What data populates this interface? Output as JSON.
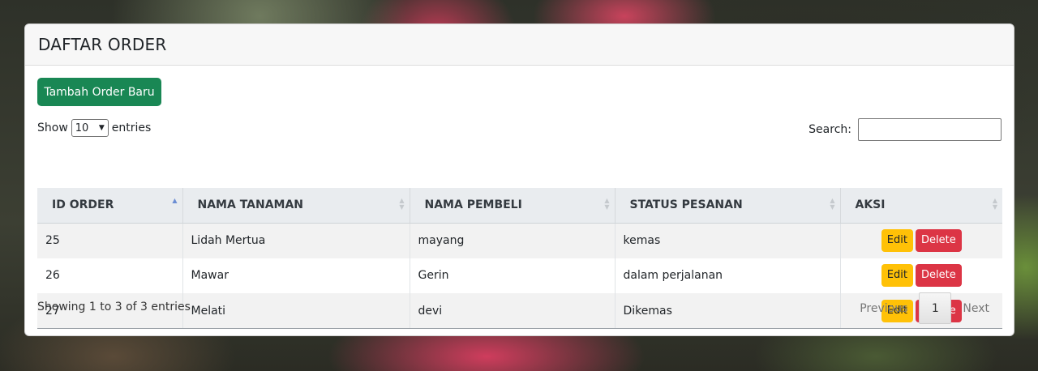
{
  "page_title": "DAFTAR ORDER",
  "add_button": "Tambah Order Baru",
  "length": {
    "prefix": "Show",
    "value": "10",
    "suffix": "entries"
  },
  "search": {
    "label": "Search:",
    "value": ""
  },
  "table": {
    "headers": [
      "ID ORDER",
      "NAMA TANAMAN",
      "NAMA PEMBELI",
      "STATUS PESANAN",
      "AKSI"
    ],
    "sorted_column": "ID ORDER",
    "sort_direction": "ascending",
    "rows": [
      {
        "id": "25",
        "tanaman": "Lidah Mertua",
        "pembeli": "mayang",
        "status": "kemas"
      },
      {
        "id": "26",
        "tanaman": "Mawar",
        "pembeli": "Gerin",
        "status": "dalam perjalanan"
      },
      {
        "id": "27",
        "tanaman": "Melati",
        "pembeli": "devi",
        "status": "Dikemas"
      }
    ],
    "edit_label": "Edit",
    "delete_label": "Delete"
  },
  "info": "Showing 1 to 3 of 3 entries",
  "pagination": {
    "previous": "Previous",
    "current": "1",
    "next": "Next"
  },
  "colors": {
    "add_button": "#198754",
    "edit_button": "#ffc107",
    "delete_button": "#dc3545",
    "header_bg": "#e9ecef"
  },
  "icons": {
    "sort": "sort-arrows-icon",
    "select_chevron": "chevron-down-icon"
  }
}
